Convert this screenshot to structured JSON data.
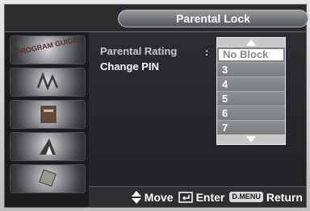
{
  "header": {
    "title": "Parental Lock"
  },
  "menu": {
    "items": [
      {
        "label": "Parental Rating"
      },
      {
        "label": "Change PIN"
      }
    ],
    "separator": ":"
  },
  "rating_dropdown": {
    "options": [
      "No Block",
      "3",
      "4",
      "5",
      "6",
      "7"
    ],
    "selected": "No Block"
  },
  "sidebar": {
    "tiles": [
      {
        "icon": "program-guide-icon",
        "text": "PROGRAM GUIDE"
      },
      {
        "icon": "channel-icon"
      },
      {
        "icon": "setup-icon"
      },
      {
        "icon": "picture-icon"
      },
      {
        "icon": "chip-icon"
      }
    ]
  },
  "footer": {
    "move_label": "Move",
    "enter_label": "Enter",
    "return_key": "D.MENU",
    "return_label": "Return"
  },
  "colors": {
    "accent": "#8d9093",
    "background": "#27292b",
    "selected_bg": "#ffffff"
  }
}
